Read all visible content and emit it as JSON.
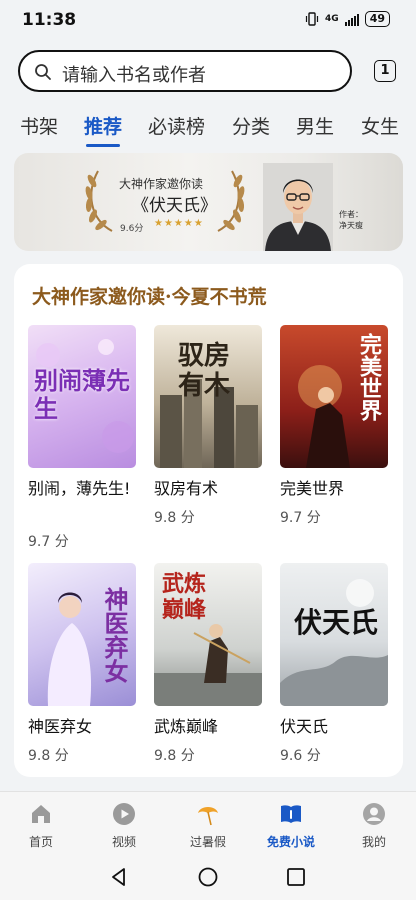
{
  "status_bar": {
    "time": "11:38",
    "network": "4G",
    "battery": "49"
  },
  "search": {
    "placeholder": "请输入书名或作者",
    "count": "1"
  },
  "tabs": [
    {
      "label": "书架"
    },
    {
      "label": "推荐"
    },
    {
      "label": "必读榜"
    },
    {
      "label": "分类"
    },
    {
      "label": "男生"
    },
    {
      "label": "女生"
    }
  ],
  "banner": {
    "title": "大神作家邀你读",
    "book": "《伏天氏》",
    "score": "9.6分",
    "stars": "★★★★★",
    "author_label": "作者：",
    "author_name": "净天瘦"
  },
  "section": {
    "title": "大神作家邀你读·今夏不书荒",
    "books": [
      {
        "title": "别闹，薄先生!",
        "score": "9.7 分",
        "cover_text": "别闹薄先生"
      },
      {
        "title": "驭房有术",
        "score": "9.8 分",
        "cover_text": "驭房有木"
      },
      {
        "title": "完美世界",
        "score": "9.7 分",
        "cover_text": "完美世界"
      },
      {
        "title": "神医弃女",
        "score": "9.8 分",
        "cover_text": "神医弃女"
      },
      {
        "title": "武炼巅峰",
        "score": "9.8 分",
        "cover_text": "武炼巅峰"
      },
      {
        "title": "伏天氏",
        "score": "9.6 分",
        "cover_text": "伏天氏"
      }
    ]
  },
  "bottom_nav": [
    {
      "label": "首页",
      "icon": "home-icon"
    },
    {
      "label": "视频",
      "icon": "video-icon"
    },
    {
      "label": "过暑假",
      "icon": "parasol-icon"
    },
    {
      "label": "免费小说",
      "icon": "book-icon"
    },
    {
      "label": "我的",
      "icon": "profile-icon"
    }
  ],
  "colors": {
    "accent": "#1a59c6",
    "section_title": "#8c5a1d",
    "star": "#d9a232"
  }
}
